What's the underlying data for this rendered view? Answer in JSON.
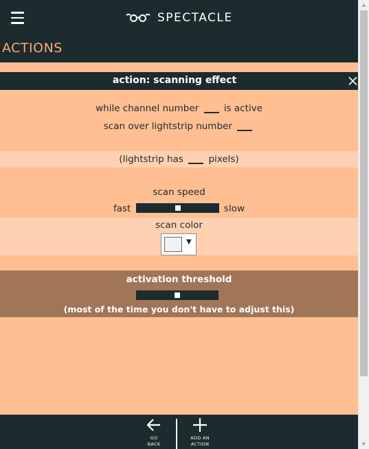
{
  "header": {
    "brand": "SPECTACLE",
    "menu_icon": "hamburger-icon",
    "logo_icon": "spectacles-logo-icon"
  },
  "page_title": "ACTIONS",
  "action": {
    "title": "action: scanning effect",
    "close_icon": "close-icon",
    "channel_prefix": "while channel number",
    "channel_suffix": "is active",
    "channel_value": "",
    "strip_prefix": "scan over lightstrip number",
    "strip_value": "",
    "pixels_prefix": "(lightstrip has",
    "pixels_suffix": "pixels)",
    "pixels_value": "",
    "speed_label": "scan speed",
    "speed_fast": "fast",
    "speed_slow": "slow",
    "speed_level": 0.5,
    "color_label": "scan color",
    "color_value": "#f2f2f2",
    "dropdown_caret": "▼"
  },
  "threshold": {
    "title": "activation threshold",
    "level": 0.5,
    "note": "(most of the time you don't have to adjust this)"
  },
  "nav": {
    "back_line1": "GO",
    "back_line2": "BACK",
    "back_icon": "arrow-left-icon",
    "add_line1": "ADD AN",
    "add_line2": "ACTION",
    "add_icon": "plus-icon"
  },
  "colors": {
    "dark": "#1c2b2e",
    "background": "#ffbf92",
    "light_band": "#ffd1b2",
    "accent": "#ffab6e",
    "threshold_band": "#a07558"
  }
}
